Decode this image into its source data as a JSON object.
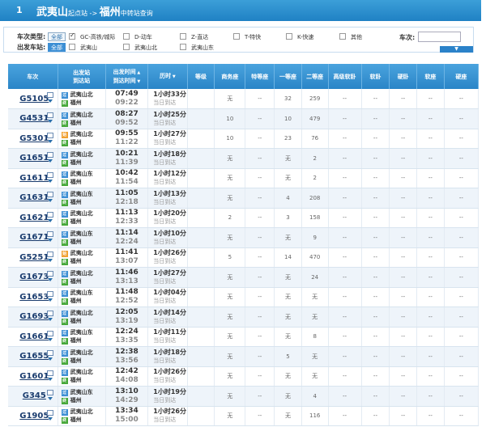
{
  "header": {
    "step": "1",
    "from": "武夷山",
    "from_note": "起点站",
    "arrow": " -> ",
    "to": "福州",
    "to_note": "中转站查询"
  },
  "filter": {
    "type_label": "车次类型:",
    "station_label": "出发车站:",
    "all": "全部",
    "types": [
      {
        "label": "GC-高铁/城际",
        "checked": true
      },
      {
        "label": "D-动车",
        "checked": false
      },
      {
        "label": "Z-直达",
        "checked": false
      },
      {
        "label": "T-特快",
        "checked": false
      },
      {
        "label": "K-快速",
        "checked": false
      },
      {
        "label": "其他",
        "checked": false
      }
    ],
    "stations": [
      {
        "label": "武夷山",
        "checked": false
      },
      {
        "label": "武夷山北",
        "checked": false
      },
      {
        "label": "武夷山东",
        "checked": false
      }
    ],
    "train_no_label": "车次:",
    "train_no_value": ""
  },
  "columns": {
    "train": "车次",
    "station_a": "出发站",
    "station_b": "到达站",
    "time_a": "出发时间",
    "time_b": "到达时间",
    "duration": "历时",
    "grade": "等级",
    "business": "商务座",
    "special": "特等座",
    "first": "一等座",
    "second": "二等座",
    "soft_sleeper_hi": "高级软卧",
    "soft_sleeper": "软卧",
    "hard_sleeper": "硬卧",
    "soft_seat": "软座",
    "hard_seat": "硬座"
  },
  "badges": {
    "start": "始",
    "pass": "过",
    "end": "终"
  },
  "rows": [
    {
      "no": "G5105",
      "from": "武夷山北",
      "from_badge": "pass",
      "to": "福州",
      "dep": "07:49",
      "arr": "09:22",
      "dur": "1小时33分",
      "note": "当日到达",
      "seats": [
        "无",
        "--",
        "32",
        "259",
        "--",
        "--",
        "--",
        "--",
        "--"
      ]
    },
    {
      "no": "G4531",
      "from": "武夷山北",
      "from_badge": "pass",
      "to": "福州",
      "dep": "08:27",
      "arr": "09:52",
      "dur": "1小时25分",
      "note": "当日到达",
      "seats": [
        "10",
        "--",
        "10",
        "479",
        "--",
        "--",
        "--",
        "--",
        "--"
      ]
    },
    {
      "no": "G5301",
      "from": "武夷山北",
      "from_badge": "start",
      "to": "福州",
      "dep": "09:55",
      "arr": "11:22",
      "dur": "1小时27分",
      "note": "当日到达",
      "seats": [
        "10",
        "--",
        "23",
        "76",
        "--",
        "--",
        "--",
        "--",
        "--"
      ]
    },
    {
      "no": "G1651",
      "from": "武夷山北",
      "from_badge": "pass",
      "to": "福州",
      "dep": "10:21",
      "arr": "11:39",
      "dur": "1小时18分",
      "note": "当日到达",
      "seats": [
        "无",
        "--",
        "无",
        "2",
        "--",
        "--",
        "--",
        "--",
        "--"
      ]
    },
    {
      "no": "G1611",
      "from": "武夷山东",
      "from_badge": "pass",
      "to": "福州",
      "dep": "10:42",
      "arr": "11:54",
      "dur": "1小时12分",
      "note": "当日到达",
      "seats": [
        "无",
        "--",
        "无",
        "2",
        "--",
        "--",
        "--",
        "--",
        "--"
      ]
    },
    {
      "no": "G1631",
      "from": "武夷山东",
      "from_badge": "pass",
      "to": "福州",
      "dep": "11:05",
      "arr": "12:18",
      "dur": "1小时13分",
      "note": "当日到达",
      "seats": [
        "无",
        "--",
        "4",
        "208",
        "--",
        "--",
        "--",
        "--",
        "--"
      ]
    },
    {
      "no": "G1621",
      "from": "武夷山北",
      "from_badge": "pass",
      "to": "福州",
      "dep": "11:13",
      "arr": "12:33",
      "dur": "1小时20分",
      "note": "当日到达",
      "seats": [
        "2",
        "--",
        "3",
        "158",
        "--",
        "--",
        "--",
        "--",
        "--"
      ]
    },
    {
      "no": "G1671",
      "from": "武夷山东",
      "from_badge": "pass",
      "to": "福州",
      "dep": "11:14",
      "arr": "12:24",
      "dur": "1小时10分",
      "note": "当日到达",
      "seats": [
        "无",
        "--",
        "无",
        "9",
        "--",
        "--",
        "--",
        "--",
        "--"
      ]
    },
    {
      "no": "G5251",
      "from": "武夷山北",
      "from_badge": "start",
      "to": "福州",
      "dep": "11:41",
      "arr": "13:07",
      "dur": "1小时26分",
      "note": "当日到达",
      "seats": [
        "5",
        "--",
        "14",
        "470",
        "--",
        "--",
        "--",
        "--",
        "--"
      ]
    },
    {
      "no": "G1673",
      "from": "武夷山北",
      "from_badge": "pass",
      "to": "福州",
      "dep": "11:46",
      "arr": "13:13",
      "dur": "1小时27分",
      "note": "当日到达",
      "seats": [
        "无",
        "--",
        "无",
        "24",
        "--",
        "--",
        "--",
        "--",
        "--"
      ]
    },
    {
      "no": "G1653",
      "from": "武夷山东",
      "from_badge": "pass",
      "to": "福州",
      "dep": "11:48",
      "arr": "12:52",
      "dur": "1小时04分",
      "note": "当日到达",
      "seats": [
        "无",
        "--",
        "无",
        "无",
        "--",
        "--",
        "--",
        "--",
        "--"
      ]
    },
    {
      "no": "G1693",
      "from": "武夷山北",
      "from_badge": "pass",
      "to": "福州",
      "dep": "12:05",
      "arr": "13:19",
      "dur": "1小时14分",
      "note": "当日到达",
      "seats": [
        "无",
        "--",
        "无",
        "无",
        "--",
        "--",
        "--",
        "--",
        "--"
      ]
    },
    {
      "no": "G1661",
      "from": "武夷山东",
      "from_badge": "pass",
      "to": "福州",
      "dep": "12:24",
      "arr": "13:35",
      "dur": "1小时11分",
      "note": "当日到达",
      "seats": [
        "无",
        "--",
        "无",
        "8",
        "--",
        "--",
        "--",
        "--",
        "--"
      ]
    },
    {
      "no": "G1655",
      "from": "武夷山北",
      "from_badge": "pass",
      "to": "福州",
      "dep": "12:38",
      "arr": "13:56",
      "dur": "1小时18分",
      "note": "当日到达",
      "seats": [
        "无",
        "--",
        "5",
        "无",
        "--",
        "--",
        "--",
        "--",
        "--"
      ]
    },
    {
      "no": "G1601",
      "from": "武夷山北",
      "from_badge": "pass",
      "to": "福州",
      "dep": "12:42",
      "arr": "14:08",
      "dur": "1小时26分",
      "note": "当日到达",
      "seats": [
        "无",
        "--",
        "无",
        "无",
        "--",
        "--",
        "--",
        "--",
        "--"
      ]
    },
    {
      "no": "G345",
      "from": "武夷山东",
      "from_badge": "pass",
      "to": "福州",
      "dep": "13:10",
      "arr": "14:29",
      "dur": "1小时19分",
      "note": "当日到达",
      "seats": [
        "无",
        "--",
        "无",
        "4",
        "--",
        "--",
        "--",
        "--",
        "--"
      ]
    },
    {
      "no": "G1905",
      "from": "武夷山北",
      "from_badge": "pass",
      "to": "福州",
      "dep": "13:34",
      "arr": "15:00",
      "dur": "1小时26分",
      "note": "当日到达",
      "seats": [
        "无",
        "--",
        "无",
        "116",
        "--",
        "--",
        "--",
        "--",
        "--"
      ]
    }
  ]
}
